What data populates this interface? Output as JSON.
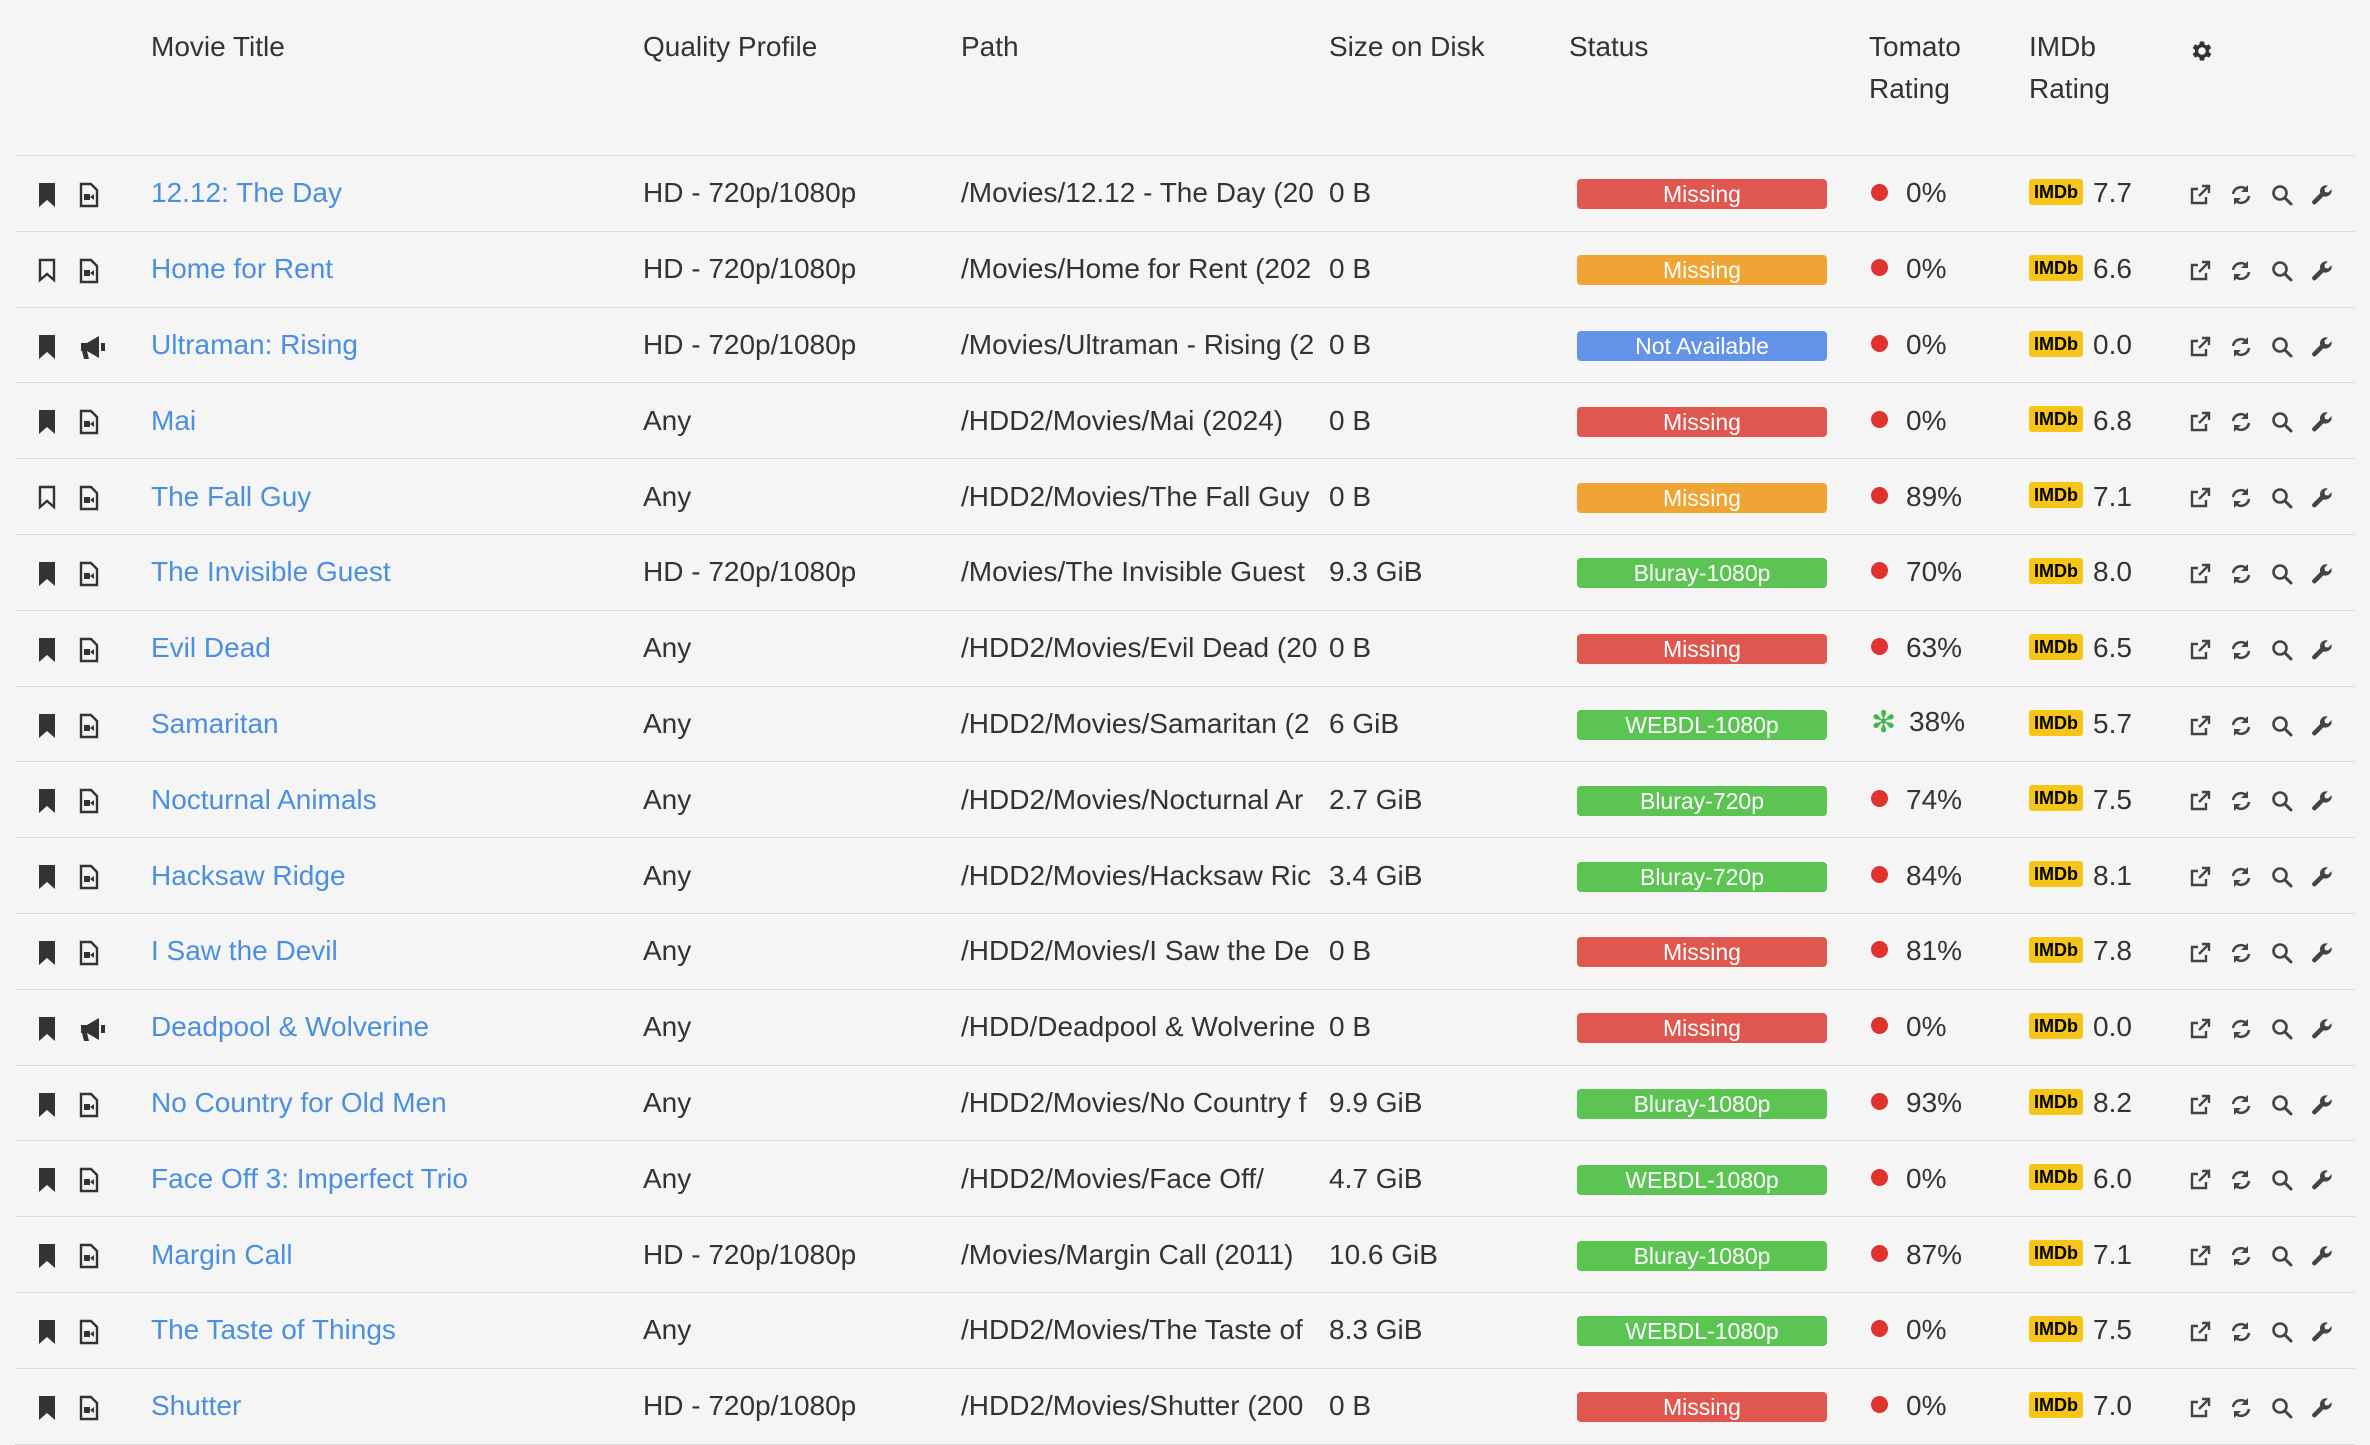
{
  "columns": {
    "title": "Movie Title",
    "quality": "Quality Profile",
    "path": "Path",
    "size": "Size on Disk",
    "status": "Status",
    "tomato_1": "Tomato",
    "tomato_2": "Rating",
    "imdb_1": "IMDb",
    "imdb_2": "Rating",
    "settings_icon": "gear-icon"
  },
  "imdb_logo_text": "IMDb",
  "status_colors": {
    "red": "#e0574f",
    "orange": "#f0a433",
    "blue": "#6393e6",
    "green": "#5cc452"
  },
  "movies": [
    {
      "monitored": true,
      "file_icon": "file-video-icon",
      "title": "12.12: The Day",
      "quality": "HD - 720p/1080p",
      "path": "/Movies/12.12 - The Day (20",
      "size": "0 B",
      "status": "Missing",
      "status_color": "red",
      "tomato": "0%",
      "tomato_icon": "tomato",
      "imdb": "7.7"
    },
    {
      "monitored": false,
      "file_icon": "file-video-icon",
      "title": "Home for Rent",
      "quality": "HD - 720p/1080p",
      "path": "/Movies/Home for Rent (202",
      "size": "0 B",
      "status": "Missing",
      "status_color": "orange",
      "tomato": "0%",
      "tomato_icon": "tomato",
      "imdb": "6.6"
    },
    {
      "monitored": true,
      "file_icon": "megaphone-icon",
      "title": "Ultraman: Rising",
      "quality": "HD - 720p/1080p",
      "path": "/Movies/Ultraman - Rising (2",
      "size": "0 B",
      "status": "Not Available",
      "status_color": "blue",
      "tomato": "0%",
      "tomato_icon": "tomato",
      "imdb": "0.0"
    },
    {
      "monitored": true,
      "file_icon": "file-video-icon",
      "title": "Mai",
      "quality": "Any",
      "path": "/HDD2/Movies/Mai (2024)",
      "size": "0 B",
      "status": "Missing",
      "status_color": "red",
      "tomato": "0%",
      "tomato_icon": "tomato",
      "imdb": "6.8"
    },
    {
      "monitored": false,
      "file_icon": "file-video-icon",
      "title": "The Fall Guy",
      "quality": "Any",
      "path": "/HDD2/Movies/The Fall Guy",
      "size": "0 B",
      "status": "Missing",
      "status_color": "orange",
      "tomato": "89%",
      "tomato_icon": "tomato",
      "imdb": "7.1"
    },
    {
      "monitored": true,
      "file_icon": "file-video-icon",
      "title": "The Invisible Guest",
      "quality": "HD - 720p/1080p",
      "path": "/Movies/The Invisible Guest",
      "size": "9.3 GiB",
      "status": "Bluray-1080p",
      "status_color": "green",
      "tomato": "70%",
      "tomato_icon": "tomato",
      "imdb": "8.0"
    },
    {
      "monitored": true,
      "file_icon": "file-video-icon",
      "title": "Evil Dead",
      "quality": "Any",
      "path": "/HDD2/Movies/Evil Dead (20",
      "size": "0 B",
      "status": "Missing",
      "status_color": "red",
      "tomato": "63%",
      "tomato_icon": "tomato",
      "imdb": "6.5"
    },
    {
      "monitored": true,
      "file_icon": "file-video-icon",
      "title": "Samaritan",
      "quality": "Any",
      "path": "/HDD2/Movies/Samaritan (2",
      "size": "6 GiB",
      "status": "WEBDL-1080p",
      "status_color": "green",
      "tomato": "38%",
      "tomato_icon": "splat",
      "imdb": "5.7"
    },
    {
      "monitored": true,
      "file_icon": "file-video-icon",
      "title": "Nocturnal Animals",
      "quality": "Any",
      "path": "/HDD2/Movies/Nocturnal Ar",
      "size": "2.7 GiB",
      "status": "Bluray-720p",
      "status_color": "green",
      "tomato": "74%",
      "tomato_icon": "tomato",
      "imdb": "7.5"
    },
    {
      "monitored": true,
      "file_icon": "file-video-icon",
      "title": "Hacksaw Ridge",
      "quality": "Any",
      "path": "/HDD2/Movies/Hacksaw Ric",
      "size": "3.4 GiB",
      "status": "Bluray-720p",
      "status_color": "green",
      "tomato": "84%",
      "tomato_icon": "tomato",
      "imdb": "8.1"
    },
    {
      "monitored": true,
      "file_icon": "file-video-icon",
      "title": "I Saw the Devil",
      "quality": "Any",
      "path": "/HDD2/Movies/I Saw the De",
      "size": "0 B",
      "status": "Missing",
      "status_color": "red",
      "tomato": "81%",
      "tomato_icon": "tomato",
      "imdb": "7.8"
    },
    {
      "monitored": true,
      "file_icon": "megaphone-icon",
      "title": "Deadpool & Wolverine",
      "quality": "Any",
      "path": "/HDD/Deadpool & Wolverine",
      "size": "0 B",
      "status": "Missing",
      "status_color": "red",
      "tomato": "0%",
      "tomato_icon": "tomato",
      "imdb": "0.0"
    },
    {
      "monitored": true,
      "file_icon": "file-video-icon",
      "title": "No Country for Old Men",
      "quality": "Any",
      "path": "/HDD2/Movies/No Country f",
      "size": "9.9 GiB",
      "status": "Bluray-1080p",
      "status_color": "green",
      "tomato": "93%",
      "tomato_icon": "tomato",
      "imdb": "8.2"
    },
    {
      "monitored": true,
      "file_icon": "file-video-icon",
      "title": "Face Off 3: Imperfect Trio",
      "quality": "Any",
      "path": "/HDD2/Movies/Face Off/",
      "size": "4.7 GiB",
      "status": "WEBDL-1080p",
      "status_color": "green",
      "tomato": "0%",
      "tomato_icon": "tomato",
      "imdb": "6.0"
    },
    {
      "monitored": true,
      "file_icon": "file-video-icon",
      "title": "Margin Call",
      "quality": "HD - 720p/1080p",
      "path": "/Movies/Margin Call (2011)",
      "size": "10.6 GiB",
      "status": "Bluray-1080p",
      "status_color": "green",
      "tomato": "87%",
      "tomato_icon": "tomato",
      "imdb": "7.1"
    },
    {
      "monitored": true,
      "file_icon": "file-video-icon",
      "title": "The Taste of Things",
      "quality": "Any",
      "path": "/HDD2/Movies/The Taste of",
      "size": "8.3 GiB",
      "status": "WEBDL-1080p",
      "status_color": "green",
      "tomato": "0%",
      "tomato_icon": "tomato",
      "imdb": "7.5"
    },
    {
      "monitored": true,
      "file_icon": "file-video-icon",
      "title": "Shutter",
      "quality": "HD - 720p/1080p",
      "path": "/HDD2/Movies/Shutter (200",
      "size": "0 B",
      "status": "Missing",
      "status_color": "red",
      "tomato": "0%",
      "tomato_icon": "tomato",
      "imdb": "7.0"
    }
  ]
}
